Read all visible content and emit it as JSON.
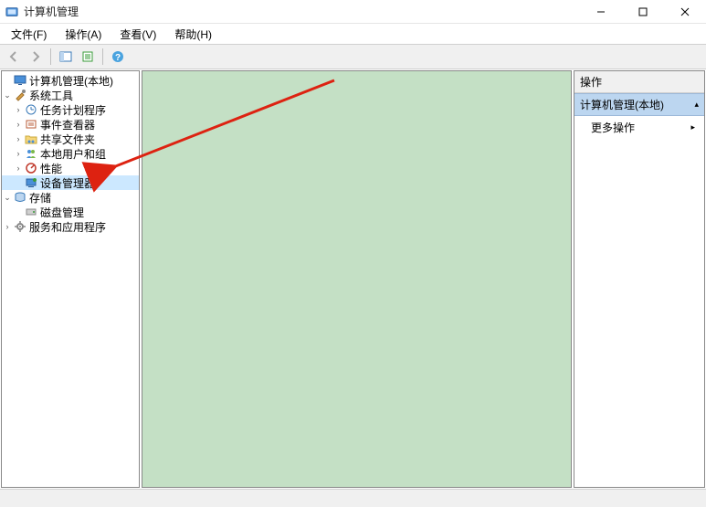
{
  "window": {
    "title": "计算机管理"
  },
  "menu": {
    "file": "文件(F)",
    "action": "操作(A)",
    "view": "查看(V)",
    "help": "帮助(H)"
  },
  "tree": {
    "root": "计算机管理(本地)",
    "system_tools": "系统工具",
    "task_scheduler": "任务计划程序",
    "event_viewer": "事件查看器",
    "shared_folders": "共享文件夹",
    "local_users": "本地用户和组",
    "performance": "性能",
    "device_manager": "设备管理器",
    "storage": "存储",
    "disk_management": "磁盘管理",
    "services_apps": "服务和应用程序"
  },
  "actions": {
    "header": "操作",
    "section_title": "计算机管理(本地)",
    "more_actions": "更多操作"
  }
}
